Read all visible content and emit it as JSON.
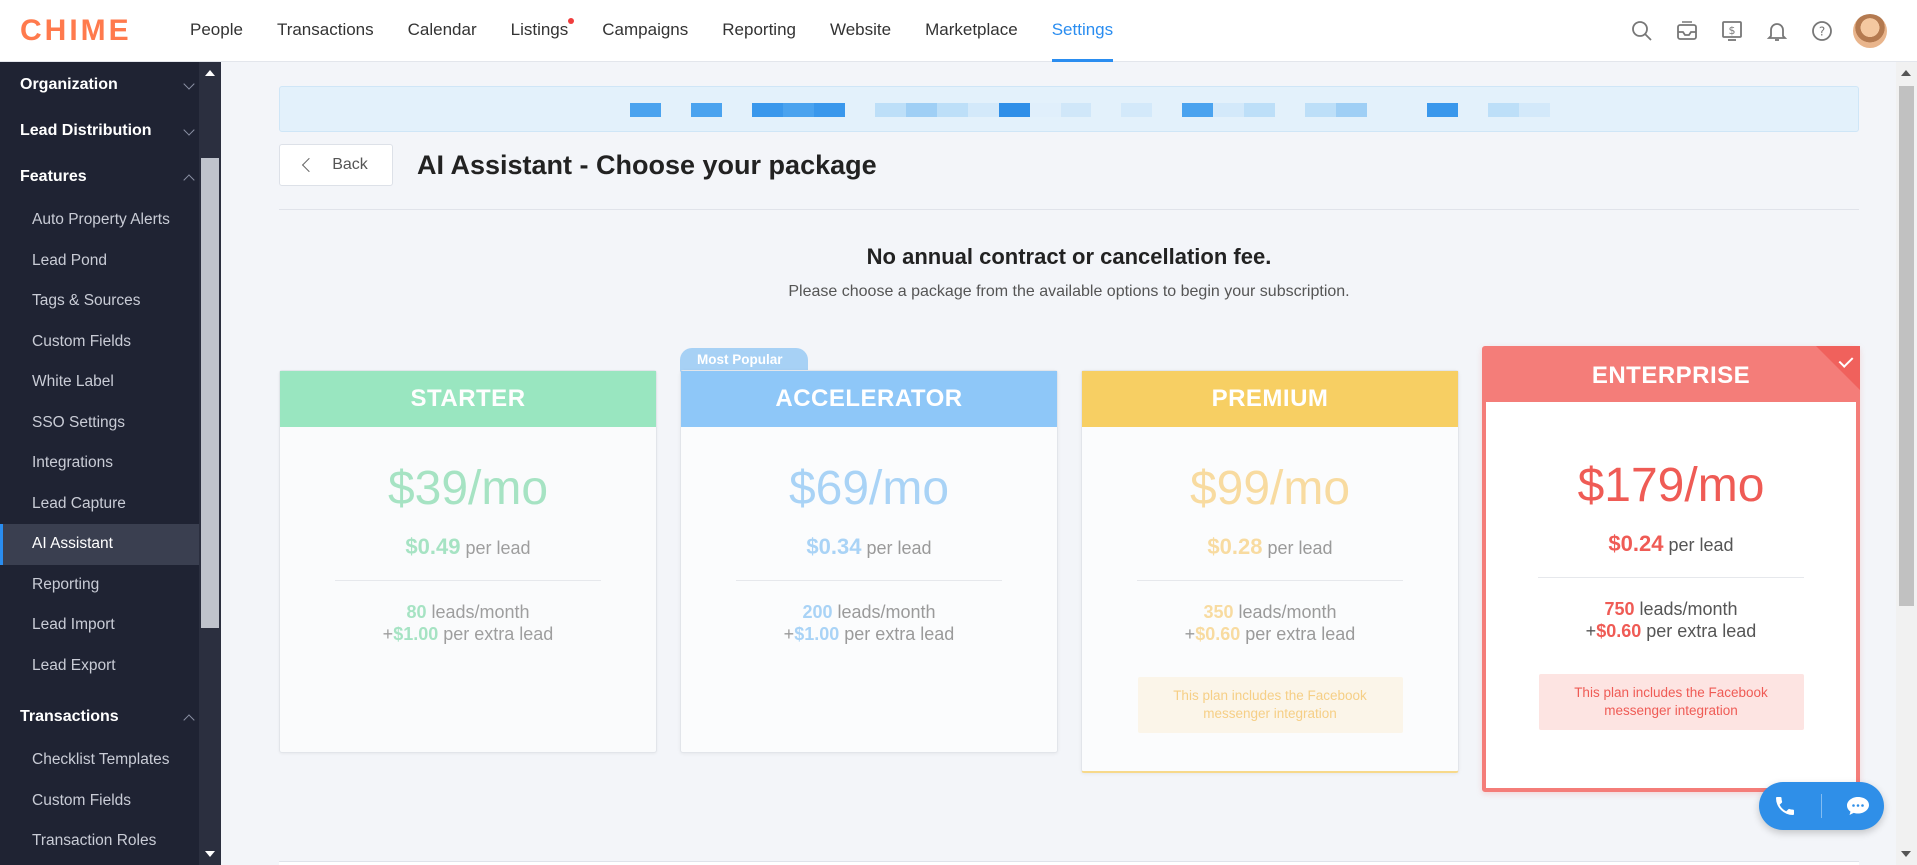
{
  "app": {
    "logo": "CHIME"
  },
  "nav": {
    "items": [
      {
        "label": "People"
      },
      {
        "label": "Transactions"
      },
      {
        "label": "Calendar"
      },
      {
        "label": "Listings"
      },
      {
        "label": "Campaigns"
      },
      {
        "label": "Reporting"
      },
      {
        "label": "Website"
      },
      {
        "label": "Marketplace"
      },
      {
        "label": "Settings"
      }
    ],
    "active": "Settings",
    "icons": [
      "search-icon",
      "inbox-icon",
      "billing-icon",
      "bell-icon",
      "help-icon",
      "avatar"
    ]
  },
  "sidebar": {
    "sections": [
      {
        "label": "Organization"
      },
      {
        "label": "Lead Distribution"
      },
      {
        "label": "Features"
      },
      {
        "label": "Transactions"
      }
    ],
    "features_items": [
      {
        "label": "Auto Property Alerts"
      },
      {
        "label": "Lead Pond"
      },
      {
        "label": "Tags & Sources"
      },
      {
        "label": "Custom Fields"
      },
      {
        "label": "White Label"
      },
      {
        "label": "SSO Settings"
      },
      {
        "label": "Integrations"
      },
      {
        "label": "Lead Capture"
      },
      {
        "label": "AI Assistant"
      },
      {
        "label": "Reporting"
      },
      {
        "label": "Lead Import"
      },
      {
        "label": "Lead Export"
      }
    ],
    "transactions_items": [
      {
        "label": "Checklist Templates"
      },
      {
        "label": "Custom Fields"
      },
      {
        "label": "Transaction Roles"
      }
    ],
    "active_item": "AI Assistant"
  },
  "header": {
    "back_label": "Back",
    "title": "AI Assistant - Choose your package"
  },
  "intro": {
    "headline": "No annual contract or cancellation fee.",
    "subtext": "Please choose a package from the available options to begin your subscription."
  },
  "plans": [
    {
      "name": "STARTER",
      "price": "$39/mo",
      "per_lead_price": "$0.49",
      "per_lead_label": "per lead",
      "leads": "80",
      "leads_label": "leads/month",
      "extra_prefix": "+",
      "extra_price": "$1.00",
      "extra_label": "per extra lead",
      "color": "#95e6bd"
    },
    {
      "name": "ACCELERATOR",
      "badge": "Most Popular",
      "price": "$69/mo",
      "per_lead_price": "$0.34",
      "per_lead_label": "per lead",
      "leads": "200",
      "leads_label": "leads/month",
      "extra_prefix": "+",
      "extra_price": "$1.00",
      "extra_label": "per extra lead",
      "color": "#8ec7f8"
    },
    {
      "name": "PREMIUM",
      "price": "$99/mo",
      "per_lead_price": "$0.28",
      "per_lead_label": "per lead",
      "leads": "350",
      "leads_label": "leads/month",
      "extra_prefix": "+",
      "extra_price": "$0.60",
      "extra_label": "per extra lead",
      "note": "This plan includes the Facebook messenger integration",
      "color": "#f7cf63"
    },
    {
      "name": "ENTERPRISE",
      "price": "$179/mo",
      "per_lead_price": "$0.24",
      "per_lead_label": "per lead",
      "leads": "750",
      "leads_label": "leads/month",
      "extra_prefix": "+",
      "extra_price": "$0.60",
      "extra_label": "per extra lead",
      "note": "This plan includes the Facebook messenger integration",
      "selected": true,
      "color": "#f47d79"
    }
  ],
  "widget": {
    "icons": [
      "phone-icon",
      "chat-icon"
    ]
  }
}
